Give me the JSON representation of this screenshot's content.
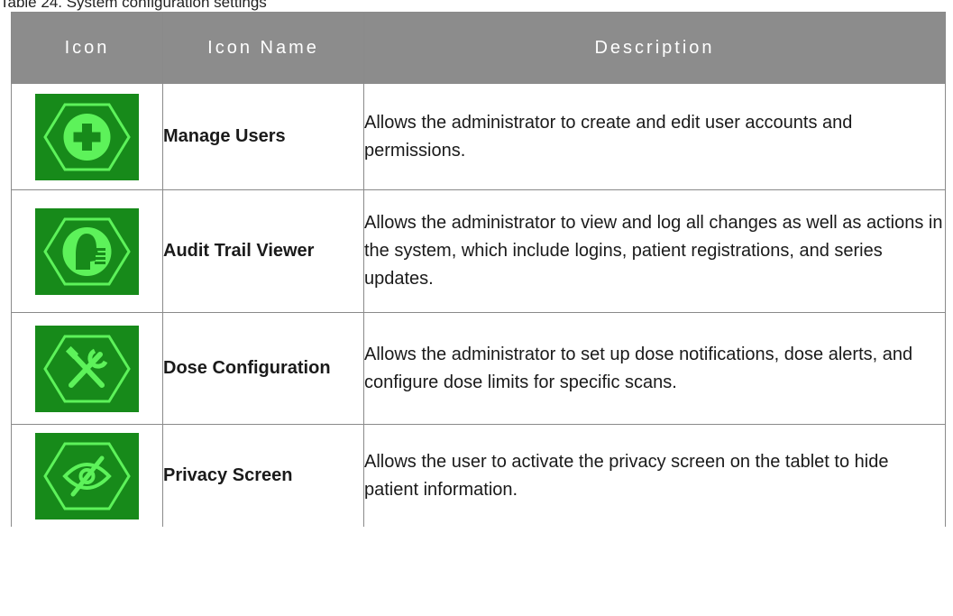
{
  "caption": "Table 24. System configuration settings",
  "header": {
    "icon": "Icon",
    "icon_name": "Icon Name",
    "description": "Description"
  },
  "rows": [
    {
      "icon": "plus-hexagon-icon",
      "name": "Manage Users",
      "description": "Allows the administrator to create and edit user accounts and permissions."
    },
    {
      "icon": "person-document-hexagon-icon",
      "name": "Audit Trail Viewer",
      "description": "Allows the administrator to view and log all changes as well as actions in the system, which include logins, patient registrations, and series updates."
    },
    {
      "icon": "tools-hexagon-icon",
      "name": "Dose Configuration",
      "description": "Allows the administrator to set up dose notifications, dose alerts, and configure dose limits for specific scans."
    },
    {
      "icon": "eye-slash-hexagon-icon",
      "name": "Privacy Screen",
      "description": "Allows the user to activate the privacy screen on the tablet to hide patient information."
    }
  ],
  "colors": {
    "header_bg": "#8c8c8c",
    "icon_bg": "#178a1a",
    "icon_fg": "#5df25a"
  }
}
